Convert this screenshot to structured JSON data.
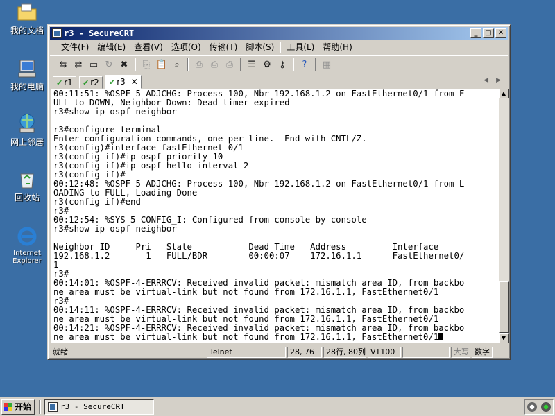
{
  "desktop": {
    "icons": [
      {
        "label": "我的文档"
      },
      {
        "label": "我的电脑"
      },
      {
        "label": "网上邻居"
      },
      {
        "label": "回收站"
      },
      {
        "label": "Internet Explorer"
      }
    ]
  },
  "window": {
    "title": "r3 - SecureCRT",
    "menu": [
      "文件(F)",
      "编辑(E)",
      "查看(V)",
      "选项(O)",
      "传输(T)",
      "脚本(S)",
      "工具(L)",
      "帮助(H)"
    ],
    "toolbar_icons": [
      "connect-icon",
      "quick-connect-icon",
      "connect-in-tab-icon",
      "reconnect-icon",
      "disconnect-icon",
      "copy-icon",
      "paste-icon",
      "find-icon",
      "print-icon",
      "print-selection-icon",
      "print-setup-icon",
      "session-options-icon",
      "global-options-icon",
      "keymap-icon",
      "help-icon",
      "script-icon"
    ],
    "tabs": [
      {
        "label": "r1",
        "status": "connected"
      },
      {
        "label": "r2",
        "status": "connected"
      },
      {
        "label": "r3",
        "status": "connected",
        "active": true
      }
    ],
    "terminal_lines": [
      "00:11:51: %OSPF-5-ADJCHG: Process 100, Nbr 192.168.1.2 on FastEthernet0/1 from F",
      "ULL to DOWN, Neighbor Down: Dead timer expired",
      "r3#show ip ospf neighbor",
      "",
      "r3#configure terminal",
      "Enter configuration commands, one per line.  End with CNTL/Z.",
      "r3(config)#interface fastEthernet 0/1",
      "r3(config-if)#ip ospf priority 10",
      "r3(config-if)#ip ospf hello-interval 2",
      "r3(config-if)#",
      "00:12:48: %OSPF-5-ADJCHG: Process 100, Nbr 192.168.1.2 on FastEthernet0/1 from L",
      "OADING to FULL, Loading Done",
      "r3(config-if)#end",
      "r3#",
      "00:12:54: %SYS-5-CONFIG_I: Configured from console by console",
      "r3#show ip ospf neighbor",
      "",
      "Neighbor ID     Pri   State           Dead Time   Address         Interface",
      "192.168.1.2       1   FULL/BDR        00:00:07    172.16.1.1      FastEthernet0/",
      "1",
      "r3#",
      "00:14:01: %OSPF-4-ERRRCV: Received invalid packet: mismatch area ID, from backbo",
      "ne area must be virtual-link but not found from 172.16.1.1, FastEthernet0/1",
      "r3#",
      "00:14:11: %OSPF-4-ERRRCV: Received invalid packet: mismatch area ID, from backbo",
      "ne area must be virtual-link but not found from 172.16.1.1, FastEthernet0/1",
      "00:14:21: %OSPF-4-ERRRCV: Received invalid packet: mismatch area ID, from backbo",
      "ne area must be virtual-link but not found from 172.16.1.1, FastEthernet0/1"
    ],
    "status": {
      "ready": "就绪",
      "protocol": "Telnet",
      "cursor_pos": "28, 76",
      "size": "28行, 80列",
      "emulation": "VT100",
      "blank": "",
      "caps": "大写",
      "num": "数字"
    }
  },
  "taskbar": {
    "start_label": "开始",
    "task_label": "r3 - SecureCRT"
  },
  "colors": {
    "desktop": "#3a6ea5",
    "title_gradient_start": "#0a246a",
    "title_gradient_end": "#a6caf0",
    "connected_check": "#2e9a2e"
  }
}
